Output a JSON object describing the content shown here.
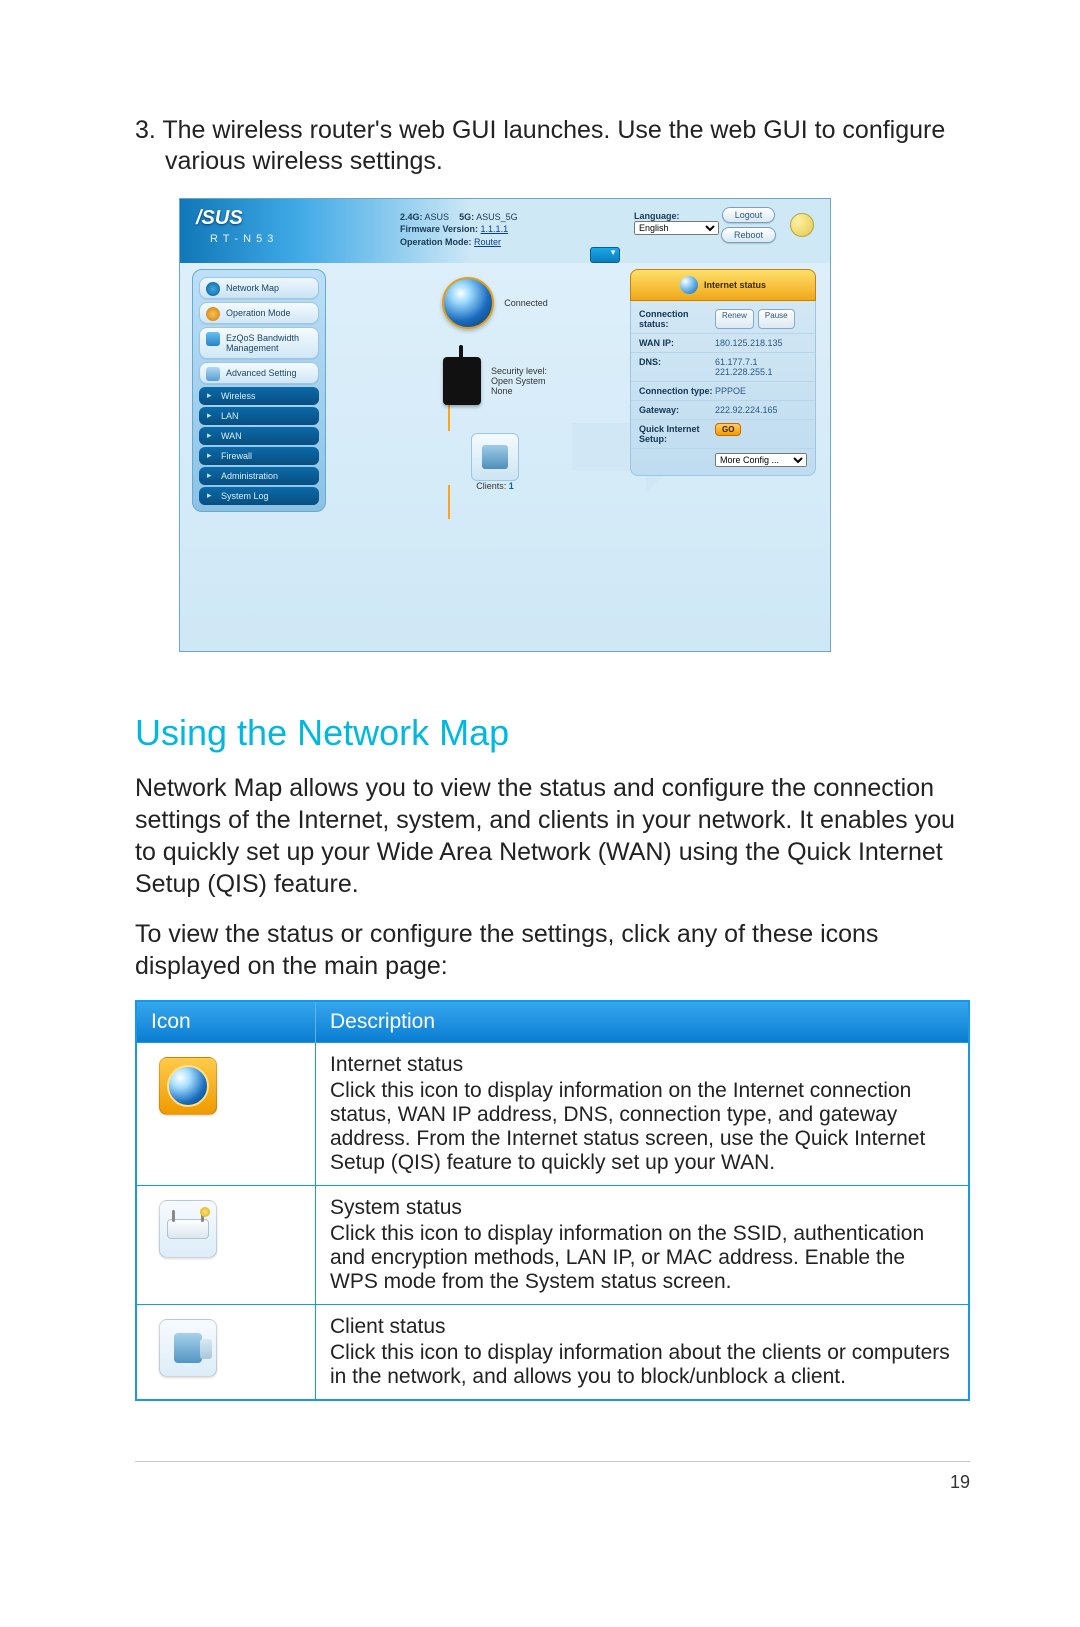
{
  "step": {
    "number": "3.",
    "text": "The wireless router's web GUI launches. Use the web GUI to configure various wireless settings."
  },
  "gui": {
    "brand": "/SUS",
    "model": "R T - N 5 3",
    "meta": {
      "ssid24_label": "2.4G:",
      "ssid24": "ASUS",
      "ssid5_label": "5G:",
      "ssid5": "ASUS_5G",
      "fw_label": "Firmware Version:",
      "fw": "1.1.1.1",
      "mode_label": "Operation Mode:",
      "mode": "Router"
    },
    "language_label": "Language:",
    "language_value": "English",
    "btn_logout": "Logout",
    "btn_reboot": "Reboot",
    "sidebar": {
      "caps": [
        "Network Map",
        "Operation Mode",
        "EzQoS Bandwidth Management",
        "Advanced Setting"
      ],
      "subs": [
        "Wireless",
        "LAN",
        "WAN",
        "Firewall",
        "Administration",
        "System Log"
      ]
    },
    "map": {
      "connected": "Connected",
      "sec_label": "Security level:",
      "sec_line1": "Open System",
      "sec_line2": "None",
      "clients_label": "Clients:",
      "clients_count": "1"
    },
    "status": {
      "title": "Internet status",
      "rows": {
        "conn_status_k": "Connection status:",
        "renew": "Renew",
        "pause": "Pause",
        "wanip_k": "WAN IP:",
        "wanip_v": "180.125.218.135",
        "dns_k": "DNS:",
        "dns_v1": "61.177.7.1",
        "dns_v2": "221.228.255.1",
        "ctype_k": "Connection type:",
        "ctype_v": "PPPOE",
        "gw_k": "Gateway:",
        "gw_v": "222.92.224.165",
        "qis_k": "Quick Internet Setup:",
        "go": "GO",
        "more": "More Config ..."
      }
    }
  },
  "section_title": "Using the Network Map",
  "para1": "Network Map allows you to view the status and configure the connection settings of the Internet, system, and clients in your network. It enables you to quickly set up your Wide Area Network (WAN) using the Quick Internet Setup (QIS) feature.",
  "para2": "To view the status or configure the settings, click any of these icons displayed on the main page:",
  "table": {
    "h_icon": "Icon",
    "h_desc": "Description",
    "rows": [
      {
        "title": "Internet status",
        "body": "Click this icon to display information on the Internet connection status, WAN IP address, DNS, connection type, and gateway address. From the Internet status screen, use the Quick Internet Setup (QIS) feature to quickly set up your WAN."
      },
      {
        "title": "System status",
        "body": "Click this icon to display information on the SSID, authentication and encryption methods, LAN IP, or MAC address. Enable the WPS mode from the System status screen."
      },
      {
        "title": "Client status",
        "body": "Click this icon to display information about the clients or computers in the network, and allows you to block/unblock a client."
      }
    ]
  },
  "page_number": "19"
}
